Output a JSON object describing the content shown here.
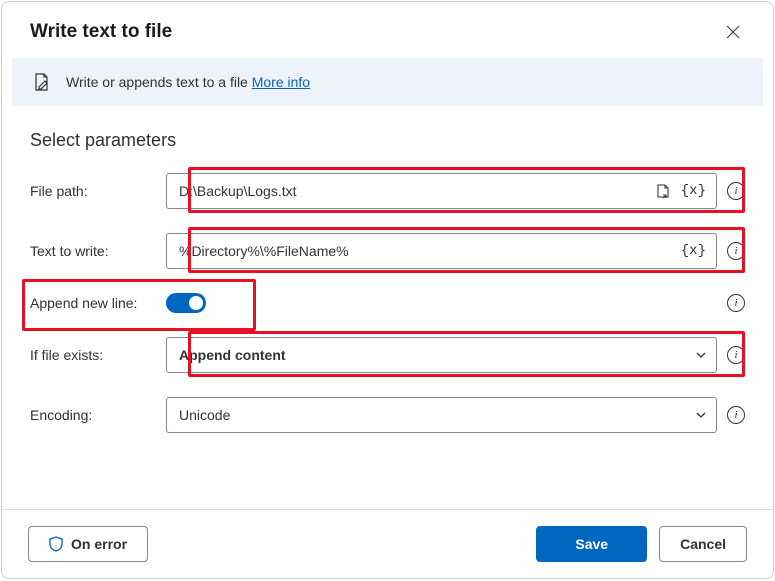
{
  "dialog": {
    "title": "Write text to file",
    "info_text": "Write or appends text to a file",
    "more_info": "More info"
  },
  "section": {
    "title": "Select parameters"
  },
  "fields": {
    "file_path": {
      "label": "File path:",
      "value": "D:\\Backup\\Logs.txt"
    },
    "text_to_write": {
      "label": "Text to write:",
      "value": "%Directory%\\%FileName%"
    },
    "append_new_line": {
      "label": "Append new line:",
      "value": true
    },
    "if_file_exists": {
      "label": "If file exists:",
      "value": "Append content"
    },
    "encoding": {
      "label": "Encoding:",
      "value": "Unicode"
    }
  },
  "buttons": {
    "on_error": "On error",
    "save": "Save",
    "cancel": "Cancel"
  }
}
